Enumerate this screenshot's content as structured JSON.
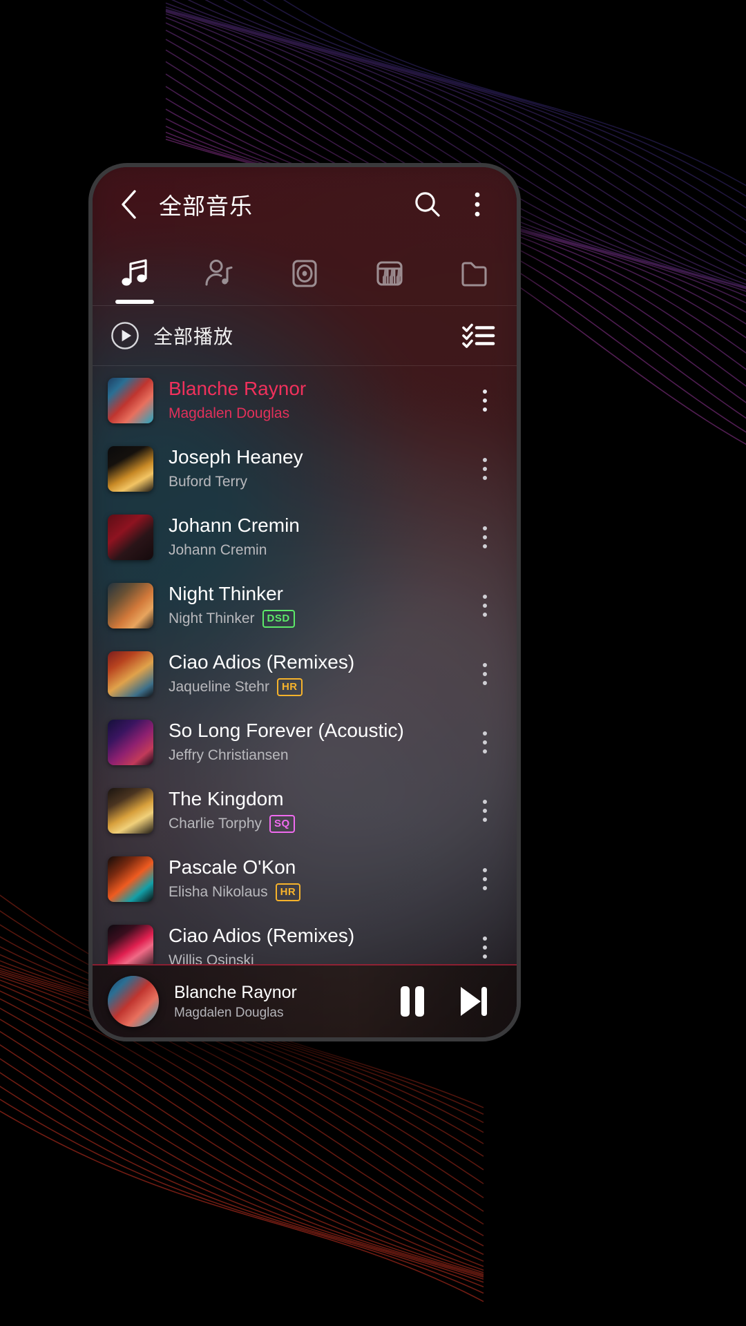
{
  "appbar": {
    "back_icon": "chevron-left-icon",
    "title": "全部音乐",
    "search_icon": "search-icon",
    "overflow_icon": "more-vertical-icon"
  },
  "tabs": [
    {
      "id": "songs",
      "icon": "music-note-icon",
      "active": true
    },
    {
      "id": "artists",
      "icon": "artist-icon",
      "active": false
    },
    {
      "id": "albums",
      "icon": "album-disc-icon",
      "active": false
    },
    {
      "id": "genres",
      "icon": "piano-icon",
      "active": false
    },
    {
      "id": "folders",
      "icon": "folder-icon",
      "active": false
    }
  ],
  "playall": {
    "icon": "play-circle-icon",
    "label": "全部播放",
    "multiselect_icon": "checklist-icon"
  },
  "songs": [
    {
      "title": "Blanche Raynor",
      "artist": "Magdalen Douglas",
      "badge": "",
      "playing": true,
      "art": "a0"
    },
    {
      "title": "Joseph Heaney",
      "artist": "Buford Terry",
      "badge": "",
      "playing": false,
      "art": "a1"
    },
    {
      "title": "Johann Cremin",
      "artist": "Johann Cremin",
      "badge": "",
      "playing": false,
      "art": "a2"
    },
    {
      "title": "Night Thinker",
      "artist": "Night Thinker",
      "badge": "DSD",
      "playing": false,
      "art": "a3"
    },
    {
      "title": "Ciao Adios (Remixes)",
      "artist": "Jaqueline Stehr",
      "badge": "HR",
      "playing": false,
      "art": "a4"
    },
    {
      "title": "So Long Forever (Acoustic)",
      "artist": "Jeffry Christiansen",
      "badge": "",
      "playing": false,
      "art": "a5"
    },
    {
      "title": "The Kingdom",
      "artist": "Charlie Torphy",
      "badge": "SQ",
      "playing": false,
      "art": "a6"
    },
    {
      "title": "Pascale O'Kon",
      "artist": "Elisha Nikolaus",
      "badge": "HR",
      "playing": false,
      "art": "a7"
    },
    {
      "title": "Ciao Adios (Remixes)",
      "artist": "Willis Osinski",
      "badge": "",
      "playing": false,
      "art": "a8"
    }
  ],
  "miniplayer": {
    "title": "Blanche Raynor",
    "artist": "Magdalen Douglas",
    "art": "a0",
    "pause_icon": "pause-icon",
    "next_icon": "skip-next-icon"
  },
  "colors": {
    "accent": "#f0315c",
    "badge_dsd": "#5dea69",
    "badge_hr": "#f7b32b",
    "badge_sq": "#f06bf0",
    "text_primary": "#ffffff",
    "text_secondary": "#b9b9bd"
  }
}
